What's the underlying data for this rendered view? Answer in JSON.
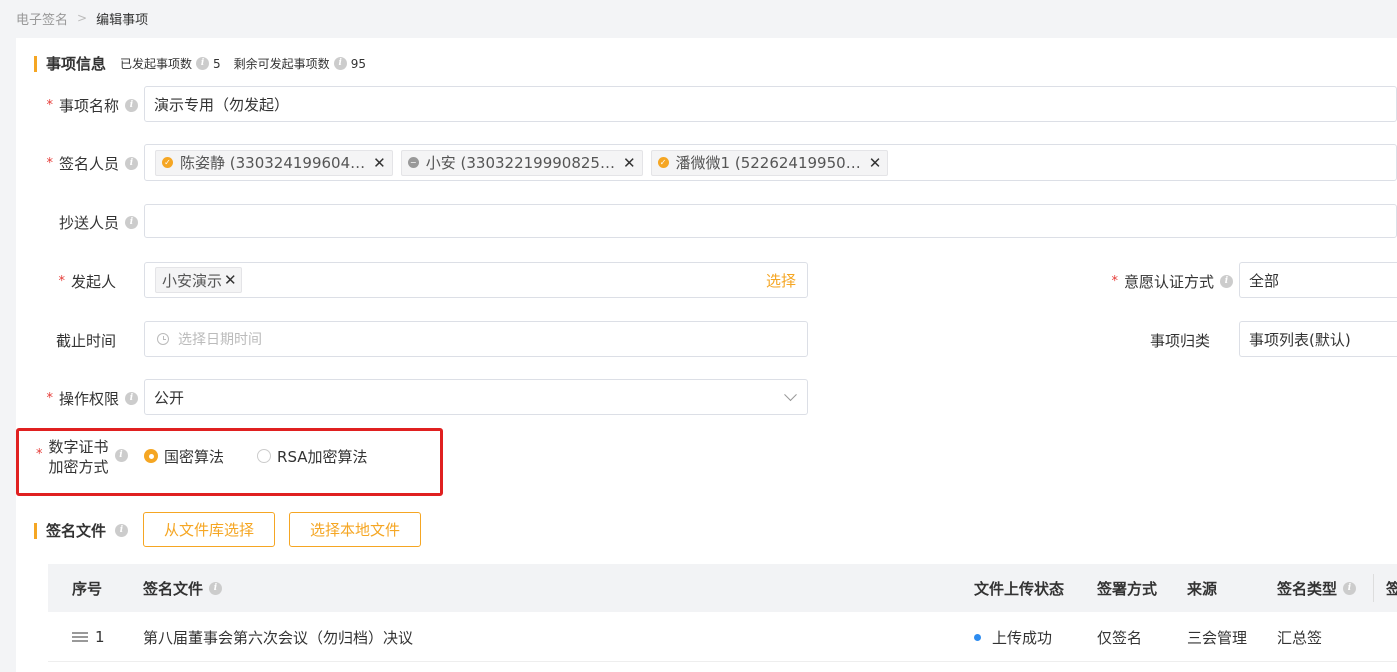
{
  "breadcrumb": {
    "root": "电子签名",
    "current": "编辑事项"
  },
  "section_info": {
    "title": "事项信息",
    "stat1_label": "已发起事项数",
    "stat1_value": "5",
    "stat2_label": "剩余可发起事项数",
    "stat2_value": "95"
  },
  "fields": {
    "name": {
      "label": "事项名称",
      "value": "演示专用（勿发起）"
    },
    "signers": {
      "label": "签名人员",
      "tags": [
        {
          "text": "陈姿静 (330324199604…",
          "status_color": "#f5a623"
        },
        {
          "text": "小安 (33032219990825…",
          "status_color": "#999999"
        },
        {
          "text": "潘微微1 (52262419950…",
          "status_color": "#f5a623"
        }
      ]
    },
    "cc": {
      "label": "抄送人员",
      "value": ""
    },
    "initiator": {
      "label": "发起人",
      "tag": "小安演示",
      "select_label": "选择"
    },
    "auth_method": {
      "label": "意愿认证方式",
      "value": "全部"
    },
    "deadline": {
      "label": "截止时间",
      "placeholder": "选择日期时间"
    },
    "category": {
      "label": "事项归类",
      "value": "事项列表(默认)"
    },
    "permission": {
      "label": "操作权限",
      "value": "公开"
    },
    "encryption": {
      "label_line1": "数字证书",
      "label_line2": "加密方式",
      "options": [
        {
          "label": "国密算法",
          "checked": true
        },
        {
          "label": "RSA加密算法",
          "checked": false
        }
      ]
    }
  },
  "section_files": {
    "title": "签名文件",
    "btn_library": "从文件库选择",
    "btn_local": "选择本地文件"
  },
  "table": {
    "headers": {
      "index": "序号",
      "file": "签名文件",
      "upload_status": "文件上传状态",
      "sign_method": "签署方式",
      "source": "来源",
      "sign_type": "签名类型",
      "extra": "签"
    },
    "rows": [
      {
        "index": "1",
        "file": "第八届董事会第六次会议（勿归档）决议",
        "upload_status": "上传成功",
        "sign_method": "仅签名",
        "source": "三会管理",
        "sign_type": "汇总签"
      }
    ]
  },
  "colors": {
    "accent": "#f5a623",
    "required": "#e53935",
    "highlight": "#e02020",
    "success_dot": "#2d8cf0"
  }
}
